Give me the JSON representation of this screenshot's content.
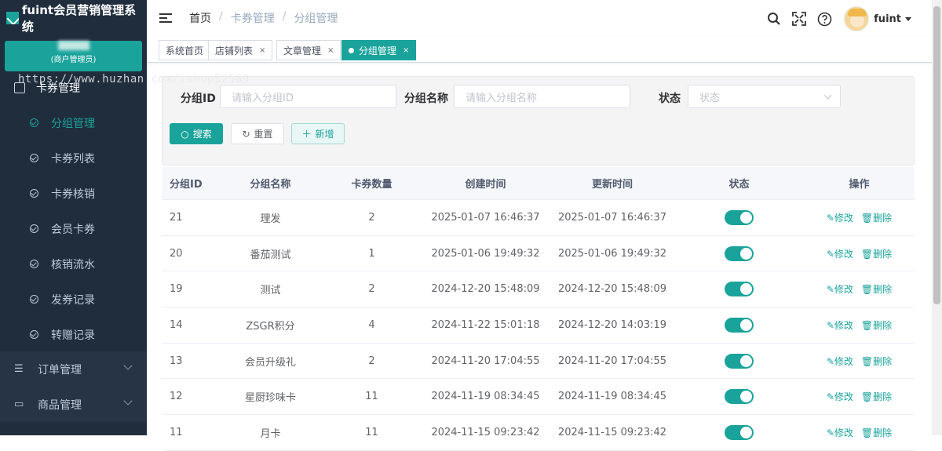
{
  "app": {
    "title": "fuint会员营销管理系统",
    "user_role": "(商户管理员)",
    "watermark": "https://www.huzhan.com/ishop52569"
  },
  "sidebar": {
    "top_item": "卡券管理",
    "sub_items": [
      "分组管理",
      "卡券列表",
      "卡券核销",
      "会员卡券",
      "核销流水",
      "发券记录",
      "转赠记录"
    ],
    "active_index": 0,
    "groups": [
      "订单管理",
      "商品管理"
    ]
  },
  "header": {
    "breadcrumb": [
      "首页",
      "卡券管理",
      "分组管理"
    ],
    "breadcrumb_sep": "/",
    "username": "fuint",
    "icons": [
      "search-icon",
      "fullscreen-icon",
      "help-icon"
    ]
  },
  "tabs": [
    {
      "label": "系统首页",
      "closable": false
    },
    {
      "label": "店铺列表",
      "closable": true
    },
    {
      "label": "文章管理",
      "closable": true
    },
    {
      "label": "分组管理",
      "closable": true,
      "active": true
    }
  ],
  "filter": {
    "id_label": "分组ID",
    "id_placeholder": "请输入分组ID",
    "name_label": "分组名称",
    "name_placeholder": "请输入分组名称",
    "status_label": "状态",
    "status_placeholder": "状态",
    "search_btn": "搜索",
    "reset_btn": "重置",
    "add_btn": "新增"
  },
  "table": {
    "headers": [
      "分组ID",
      "分组名称",
      "卡券数量",
      "创建时间",
      "更新时间",
      "状态",
      "操作"
    ],
    "edit_label": "修改",
    "delete_label": "删除",
    "rows": [
      {
        "id": "21",
        "name": "理发",
        "count": "2",
        "created": "2025-01-07 16:46:37",
        "updated": "2025-01-07 16:46:37",
        "enabled": true
      },
      {
        "id": "20",
        "name": "番茄测试",
        "count": "1",
        "created": "2025-01-06 19:49:32",
        "updated": "2025-01-06 19:49:32",
        "enabled": true
      },
      {
        "id": "19",
        "name": "测试",
        "count": "2",
        "created": "2024-12-20 15:48:09",
        "updated": "2024-12-20 15:48:09",
        "enabled": true
      },
      {
        "id": "14",
        "name": "ZSGR积分",
        "count": "4",
        "created": "2024-11-22 15:01:18",
        "updated": "2024-12-20 14:03:19",
        "enabled": true
      },
      {
        "id": "13",
        "name": "会员升级礼",
        "count": "2",
        "created": "2024-11-20 17:04:55",
        "updated": "2024-11-20 17:04:55",
        "enabled": true
      },
      {
        "id": "12",
        "name": "星厨珍味卡",
        "count": "11",
        "created": "2024-11-19 08:34:45",
        "updated": "2024-11-19 08:34:45",
        "enabled": true
      },
      {
        "id": "11",
        "name": "月卡",
        "count": "11",
        "created": "2024-11-15 09:23:42",
        "updated": "2024-11-15 09:23:42",
        "enabled": true
      }
    ]
  },
  "colors": {
    "accent": "#1aa39b",
    "sidebar_bg": "#1f2d3d"
  }
}
